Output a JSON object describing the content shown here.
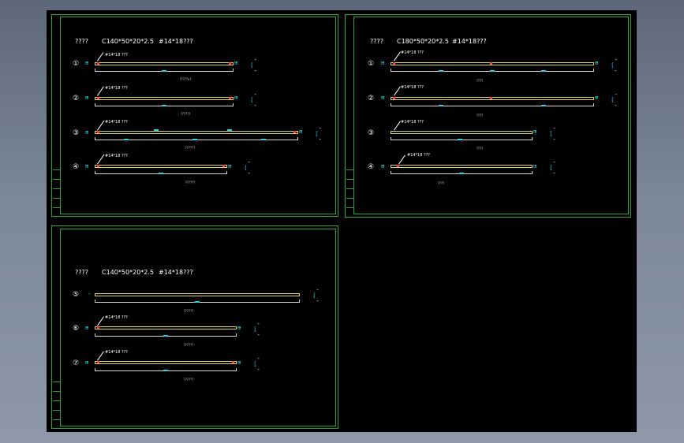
{
  "colors": {
    "background": "#7c8797",
    "canvas": "#000000",
    "frame": "#2fa33a",
    "member": "#e2d84f",
    "dimension": "#d8d8d8",
    "annotation": "#27d6e6",
    "hole": "#ff3b3b"
  },
  "sheets": [
    {
      "title": {
        "label": "????",
        "spec": "C140*50*20*2.5",
        "holes": "#14*18???"
      },
      "members": [
        {
          "num": "①",
          "label": "#14*18 ???",
          "cap": "?????x?"
        },
        {
          "num": "②",
          "label": "#14*18 ???",
          "cap": "??????"
        },
        {
          "num": "③",
          "label": "#14*18 ???",
          "cap": "??????"
        },
        {
          "num": "④",
          "label": "#14*18 ???",
          "cap": "??????"
        }
      ]
    },
    {
      "title": {
        "label": "????",
        "spec": "C180*50*20*2.5",
        "holes": "#14*18???"
      },
      "members": [
        {
          "num": "①",
          "label": "#14*18 ???",
          "cap": "????"
        },
        {
          "num": "②",
          "label": "#14*18 ???",
          "cap": "????"
        },
        {
          "num": "③",
          "label": "#14*18 ???",
          "cap": "????"
        },
        {
          "num": "④",
          "label": "#14*18 ???",
          "cap": "????"
        }
      ]
    },
    {
      "title": {
        "label": "????",
        "spec": "C140*50*20*2.5",
        "holes": "#14*18???"
      },
      "members": [
        {
          "num": "⑤",
          "label": "",
          "cap": "??????"
        },
        {
          "num": "⑥",
          "label": "#14*18 ???",
          "cap": "??????"
        },
        {
          "num": "⑦",
          "label": "#14*18 ???",
          "cap": "??????"
        }
      ]
    }
  ]
}
